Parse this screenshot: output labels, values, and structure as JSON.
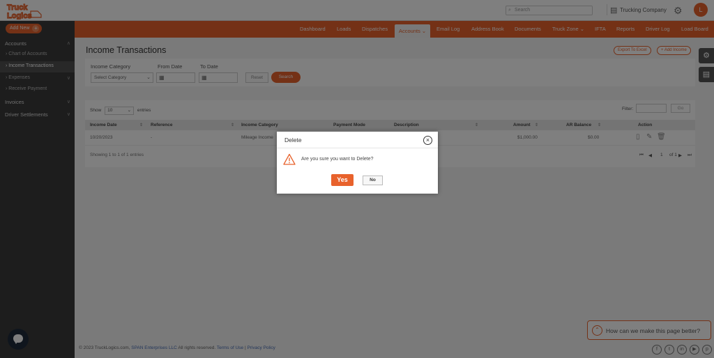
{
  "header": {
    "search_placeholder": "Search",
    "company": "Trucking Company",
    "avatar_initial": "L"
  },
  "sidebar": {
    "add_new": "Add New",
    "items": [
      {
        "label": "Accounts"
      },
      {
        "label": "Chart of Accounts"
      },
      {
        "label": "Income Transactions"
      },
      {
        "label": "Expenses"
      },
      {
        "label": "Receive Payment"
      },
      {
        "label": "Invoices"
      },
      {
        "label": "Driver Settlements"
      }
    ]
  },
  "nav": {
    "items": [
      {
        "label": "Dashboard"
      },
      {
        "label": "Loads"
      },
      {
        "label": "Dispatches"
      },
      {
        "label": "Accounts ⌄"
      },
      {
        "label": "Email Log"
      },
      {
        "label": "Address Book"
      },
      {
        "label": "Documents"
      },
      {
        "label": "Truck Zone ⌄"
      },
      {
        "label": "IFTA"
      },
      {
        "label": "Reports"
      },
      {
        "label": "Driver Log"
      },
      {
        "label": "Load Board"
      }
    ]
  },
  "page": {
    "title": "Income Transactions",
    "export_label": "Export To Excel",
    "add_label": "+ Add Income"
  },
  "filters": {
    "category_label": "Income Category",
    "category_value": "Select Category",
    "from_label": "From Date",
    "to_label": "To Date",
    "reset": "Reset",
    "search": "Search"
  },
  "table": {
    "show_label": "Show",
    "show_value": "10",
    "entries_label": "entries",
    "filter_label": "Filter:",
    "go_label": "Go",
    "columns": [
      "Income Date",
      "Reference",
      "Income Category",
      "Payment Mode",
      "Description",
      "Amount",
      "AR Balance",
      "Action"
    ],
    "rows": [
      {
        "date": "10/20/2023",
        "reference": "-",
        "category": "Mileage Income",
        "amount": "$1,000.00",
        "balance": "$0.00"
      }
    ],
    "info": "Showing 1 to 1 of 1 entries",
    "page_current": "1",
    "page_total": "of 1"
  },
  "footer": {
    "copyright": "© 2023 TruckLogics.com, ",
    "company_link": "SPAN Enterprises LLC",
    "rights": " All rights reserved. ",
    "terms": "Terms of Use",
    "sep": " | ",
    "privacy": "Privacy Policy"
  },
  "feedback": {
    "text": "How can we make this page better?"
  },
  "modal": {
    "title": "Delete",
    "message": "Are you sure you want to Delete?",
    "yes": "Yes",
    "no": "No"
  },
  "colors": {
    "accent": "#e8622c",
    "sidebar": "#3a3a3a"
  }
}
